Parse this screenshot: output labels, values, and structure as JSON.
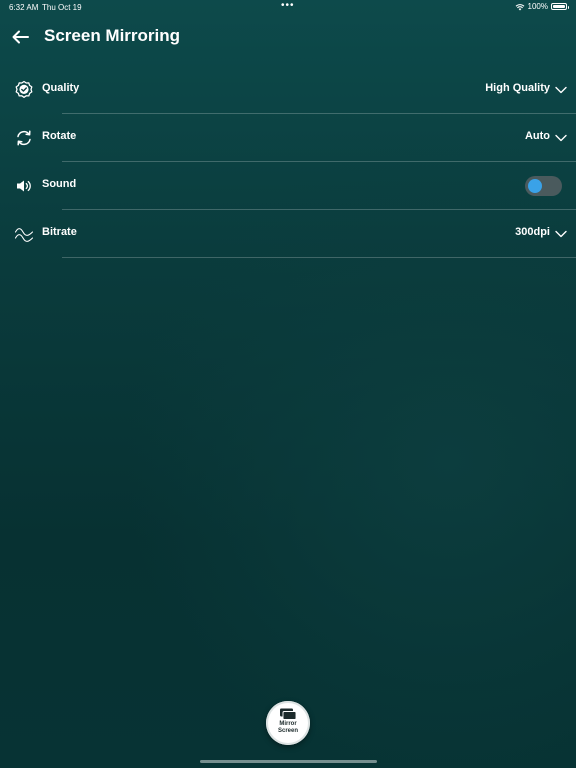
{
  "status_bar": {
    "time": "6:32 AM",
    "date": "Thu Oct 19",
    "dots": "•••",
    "battery": "100%",
    "battery_level": 1.0
  },
  "header": {
    "title": "Screen Mirroring",
    "back_icon": "arrow-left-icon"
  },
  "settings": [
    {
      "key": "quality",
      "icon": "badge-check-icon",
      "label": "Quality",
      "value": "High Quality",
      "control": "dropdown"
    },
    {
      "key": "rotate",
      "icon": "rotate-icon",
      "label": "Rotate",
      "value": "Auto",
      "control": "dropdown"
    },
    {
      "key": "sound",
      "icon": "speaker-icon",
      "label": "Sound",
      "value": "",
      "control": "toggle",
      "on": false
    },
    {
      "key": "bitrate",
      "icon": "wave-icon",
      "label": "Bitrate",
      "value": "300dpi",
      "control": "dropdown"
    }
  ],
  "mirror_button": {
    "label_line1": "Mirror",
    "label_line2": "Screen",
    "icon": "screens-icon"
  },
  "colors": {
    "background_top": "#0d4a4b",
    "background_bottom": "#073132",
    "toggle_knob": "#3aa2e8",
    "toggle_track": "#4a5a5d"
  }
}
